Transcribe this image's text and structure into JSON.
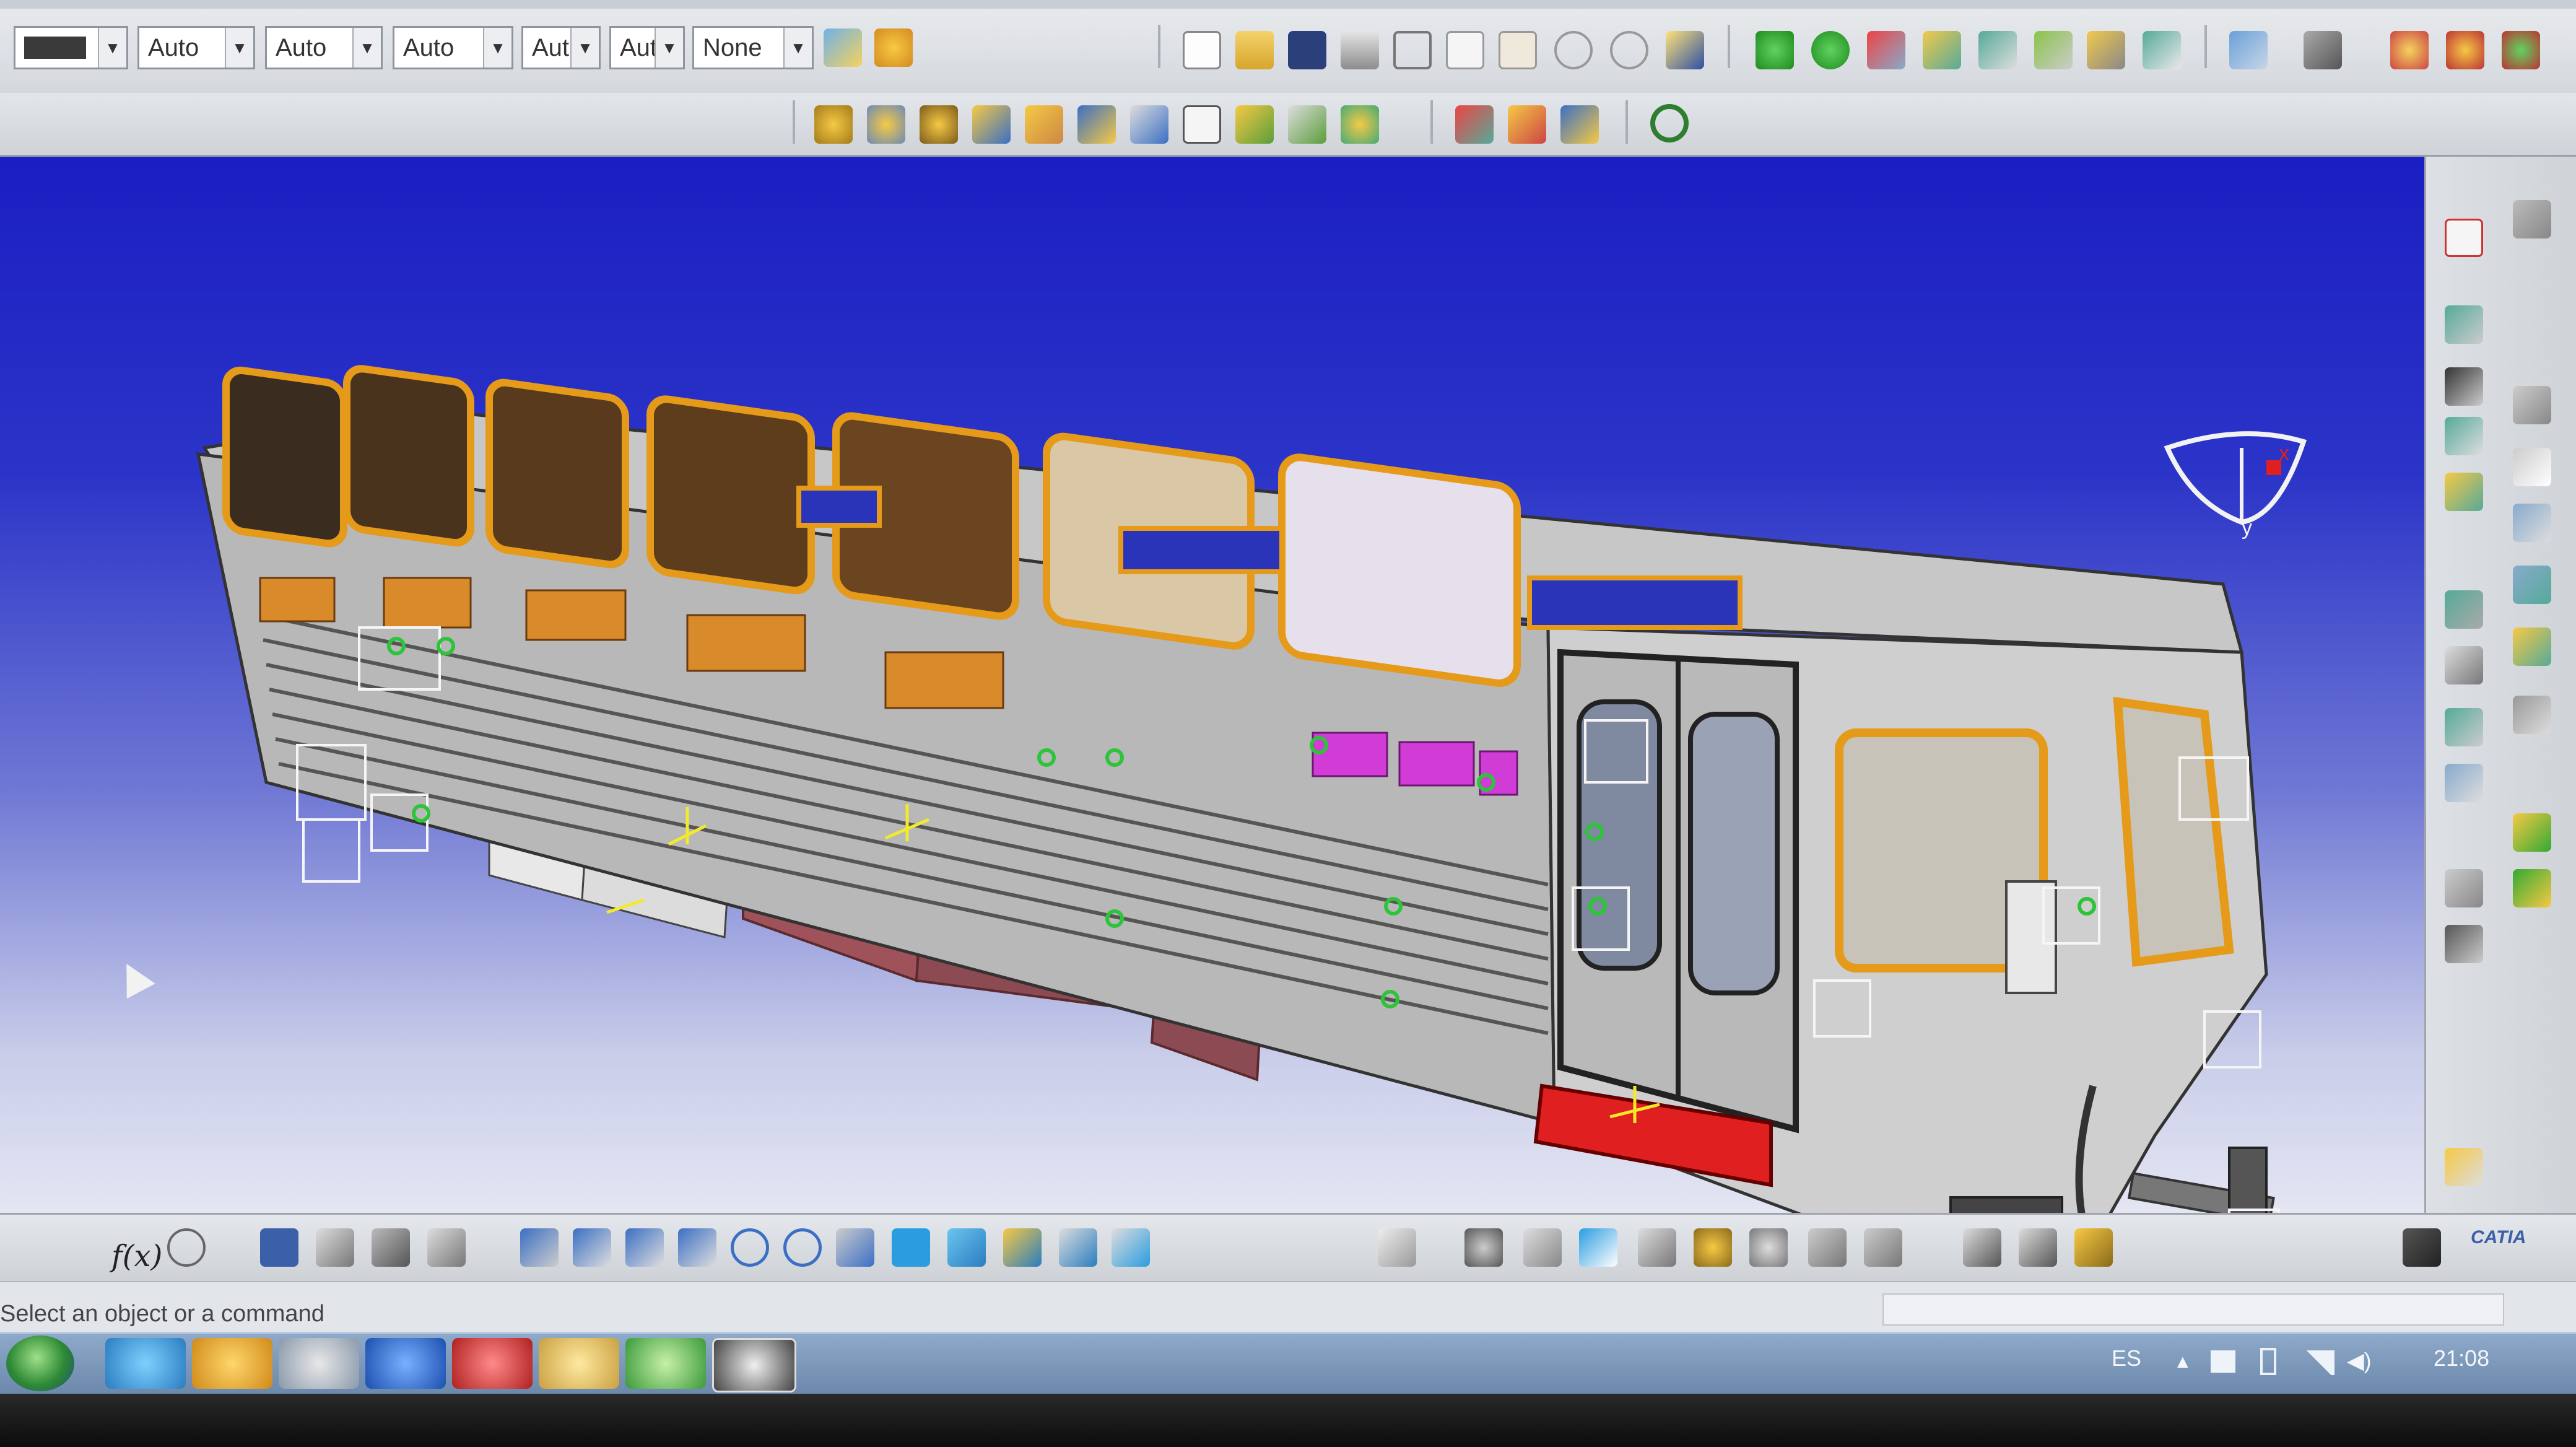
{
  "app": {
    "name": "CATIA",
    "logo_text": "CATIA"
  },
  "toolbar_top": {
    "color_combo": {
      "value": ""
    },
    "combos": [
      {
        "value": "Auto"
      },
      {
        "value": "Auto"
      },
      {
        "value": "Auto"
      },
      {
        "value": "Aut"
      },
      {
        "value": "Aut"
      },
      {
        "value": "None"
      }
    ],
    "icons": [
      "painter-icon",
      "apply-material-icon",
      "new-icon",
      "open-icon",
      "save-icon",
      "print-icon",
      "cut-icon",
      "copy-icon",
      "paste-icon",
      "undo-icon",
      "redo-icon",
      "whats-this-icon",
      "manipulate-icon",
      "snap-icon",
      "explode-icon",
      "clash-icon",
      "measure-icon",
      "annotate-icon",
      "catalog-icon",
      "sensor-icon",
      "swap-icon",
      "settings-icon",
      "tools-icon",
      "analysis-icon",
      "material-icon"
    ]
  },
  "toolbar_row2": {
    "icons": [
      "product-structure-icon",
      "existing-component-icon",
      "new-product-icon",
      "new-part-icon",
      "replace-icon",
      "graph-tree-icon",
      "generate-numbering-icon",
      "bill-of-material-icon",
      "multi-instantiation-icon",
      "fast-multi-instantiation-icon",
      "reorder-icon",
      "constraint-icon",
      "fix-icon",
      "reuse-pattern-icon",
      "update-icon"
    ]
  },
  "viewport": {
    "compass": {
      "x_label": "x",
      "y_label": "y"
    }
  },
  "toolbar_right": {
    "icons": [
      "pcs-icon",
      "assembly-icon",
      "snap-icon",
      "explode-icon",
      "clash-icon",
      "section-icon",
      "distance-icon",
      "sectioning-icon",
      "measure-between-icon",
      "measure-item-icon",
      "inertia-icon",
      "annotation-icon",
      "weld-icon",
      "scene-icon",
      "fix-together-icon",
      "contact-icon",
      "offset-icon",
      "angle-icon",
      "update-icon",
      "catalog-icon",
      "select-icon"
    ]
  },
  "toolbar_bottom": {
    "formula_label": "f(x)",
    "icons": [
      "comment-icon",
      "table-icon",
      "knowledge-icon",
      "lock-icon",
      "tree-icon",
      "fly-icon",
      "fit-all-icon",
      "pan-icon",
      "rotate-icon",
      "zoom-in-icon",
      "zoom-out-icon",
      "normal-view-icon",
      "multi-view-icon",
      "iso-view-icon",
      "shading-icon",
      "hide-show-icon",
      "swap-visible-icon",
      "eraser-icon",
      "gears-icon",
      "snap-point-icon",
      "render-icon",
      "plane-icon",
      "kinematics-icon",
      "simulation-icon",
      "clash-analysis-icon",
      "distance-analysis-icon",
      "compare-icon",
      "publish-icon",
      "capture-icon"
    ]
  },
  "statusbar": {
    "message": "Select an object or a command"
  },
  "taskbar": {
    "language": "ES",
    "clock": "21:08",
    "apps": [
      "start-icon",
      "ie-icon",
      "media-player-icon",
      "clock-icon",
      "info-icon",
      "pdf-icon",
      "folder-icon",
      "browser-icon",
      "catia-task-icon"
    ]
  }
}
